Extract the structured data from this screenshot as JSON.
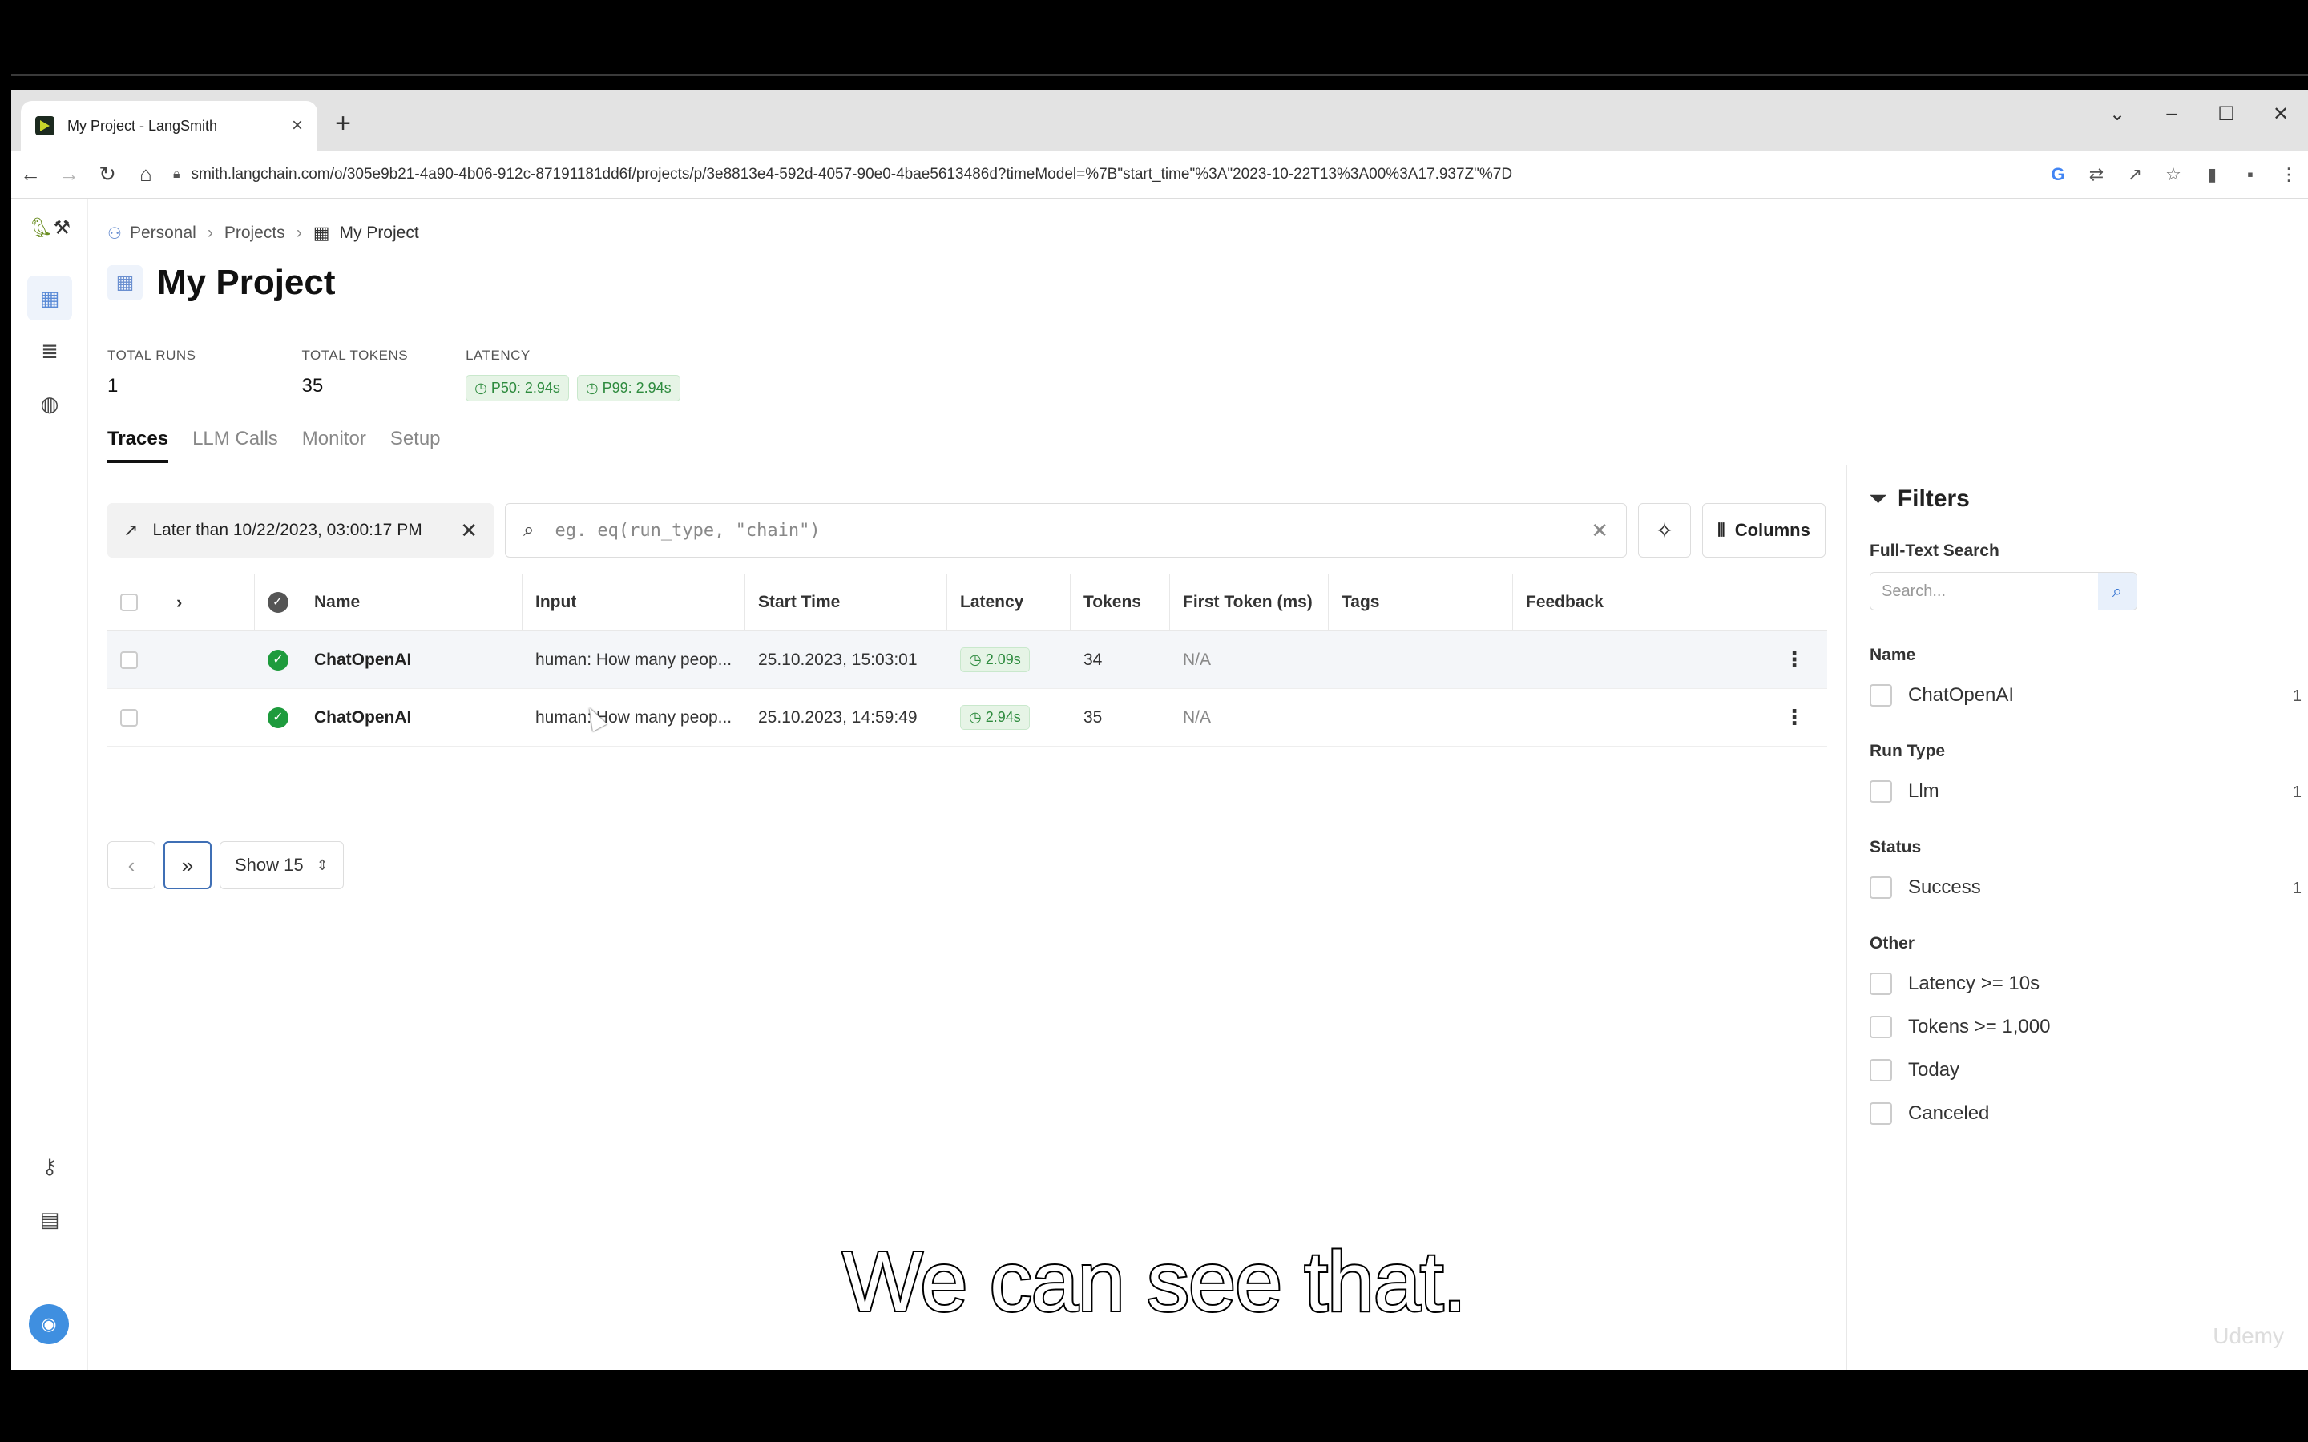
{
  "browser": {
    "tab_title": "My Project - LangSmith",
    "url": "smith.langchain.com/o/305e9b21-4a90-4b06-912c-87191181dd6f/projects/p/3e8813e4-592d-4057-90e0-4bae5613486d?timeModel=%7B\"start_time\"%3A\"2023-10-22T13%3A00%3A17.937Z\"%7D"
  },
  "breadcrumb": {
    "personal": "Personal",
    "projects": "Projects",
    "current": "My Project"
  },
  "page": {
    "title": "My Project"
  },
  "stats": {
    "total_runs_label": "TOTAL RUNS",
    "total_runs_value": "1",
    "total_tokens_label": "TOTAL TOKENS",
    "total_tokens_value": "35",
    "latency_label": "LATENCY",
    "p50": "P50: 2.94s",
    "p99": "P99: 2.94s"
  },
  "tabs": [
    "Traces",
    "LLM Calls",
    "Monitor",
    "Setup"
  ],
  "toolbar": {
    "date_filter": "Later than 10/22/2023, 03:00:17 PM",
    "search_placeholder": "eg. eq(run_type, \"chain\")",
    "columns_label": "Columns"
  },
  "table": {
    "headers": {
      "name": "Name",
      "input": "Input",
      "start_time": "Start Time",
      "latency": "Latency",
      "tokens": "Tokens",
      "first_token": "First Token (ms)",
      "tags": "Tags",
      "feedback": "Feedback"
    },
    "rows": [
      {
        "name": "ChatOpenAI",
        "input": "human: How many peop...",
        "start_time": "25.10.2023, 15:03:01",
        "latency": "2.09s",
        "tokens": "34",
        "first_token": "N/A"
      },
      {
        "name": "ChatOpenAI",
        "input": "human: How many peop...",
        "start_time": "25.10.2023, 14:59:49",
        "latency": "2.94s",
        "tokens": "35",
        "first_token": "N/A"
      }
    ]
  },
  "pager": {
    "show_label": "Show 15"
  },
  "filters": {
    "title": "Filters",
    "fulltext_label": "Full-Text Search",
    "search_placeholder": "Search...",
    "name_label": "Name",
    "name_option": "ChatOpenAI",
    "name_count": "1",
    "runtype_label": "Run Type",
    "runtype_option": "Llm",
    "runtype_count": "1",
    "status_label": "Status",
    "status_option": "Success",
    "status_count": "1",
    "other_label": "Other",
    "other_options": [
      "Latency >= 10s",
      "Tokens >= 1,000",
      "Today",
      "Canceled"
    ]
  },
  "video": {
    "caption": "We can see that.",
    "watermark": "Udemy"
  },
  "colors": {
    "accent": "#3f8fe0",
    "success": "#1e9b3d"
  }
}
